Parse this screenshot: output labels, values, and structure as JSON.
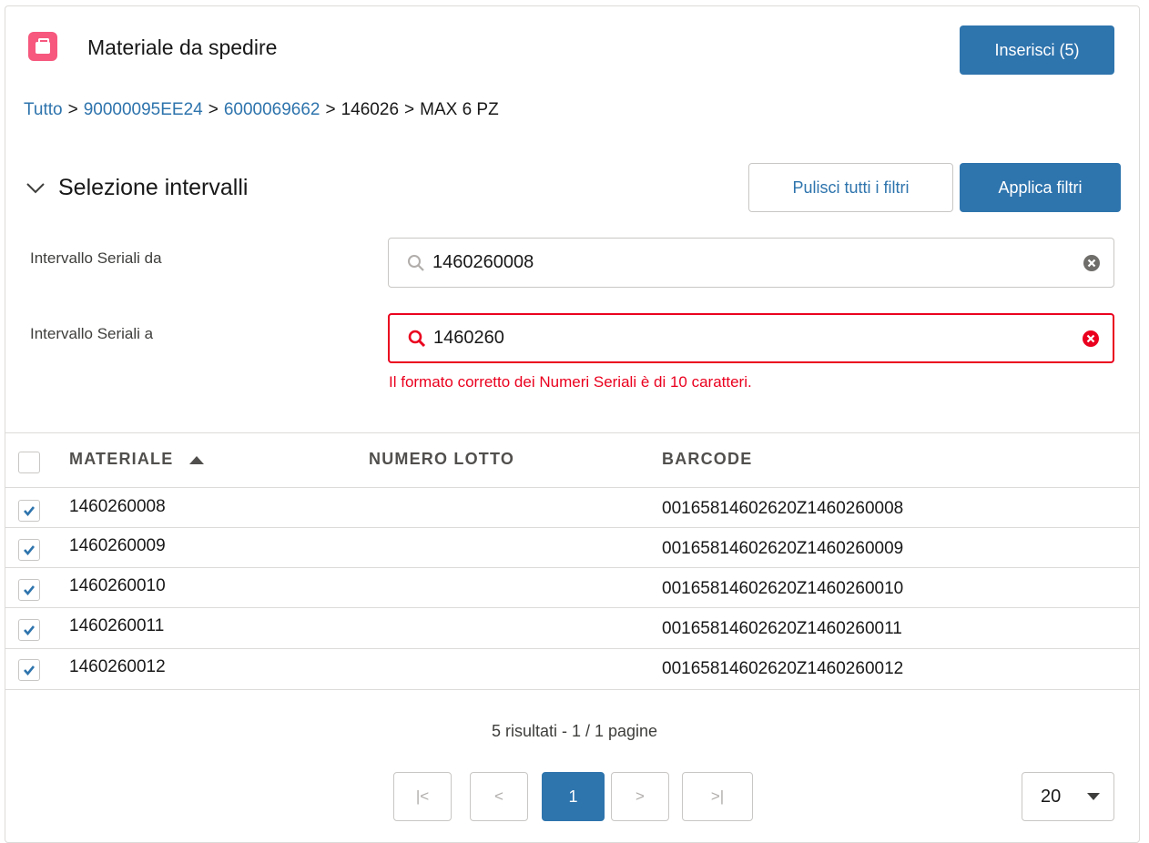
{
  "header": {
    "title": "Materiale da spedire",
    "insert_button": "Inserisci (5)",
    "icon": "briefcase-icon",
    "icon_color": "#f6587e"
  },
  "breadcrumb": {
    "items": [
      "Tutto",
      "90000095EE24",
      "6000069662",
      "146026",
      "MAX 6 PZ"
    ],
    "separator": ">"
  },
  "filters": {
    "section_title": "Selezione intervalli",
    "clear_button": "Pulisci tutti i filtri",
    "apply_button": "Applica filtri",
    "from": {
      "label": "Intervallo Seriali da",
      "value": "1460260008"
    },
    "to": {
      "label": "Intervallo Seriali a",
      "value": "1460260",
      "error": "Il formato corretto dei Numeri Seriali è di 10 caratteri."
    }
  },
  "table": {
    "columns": [
      "MATERIALE",
      "NUMERO LOTTO",
      "BARCODE"
    ],
    "sort_column": "MATERIALE",
    "sort_direction": "ascending",
    "rows": [
      {
        "materiale": "1460260008",
        "lotto": "",
        "barcode": "00165814602620Z1460260008",
        "checked": true
      },
      {
        "materiale": "1460260009",
        "lotto": "",
        "barcode": "00165814602620Z1460260009",
        "checked": true
      },
      {
        "materiale": "1460260010",
        "lotto": "",
        "barcode": "00165814602620Z1460260010",
        "checked": true
      },
      {
        "materiale": "1460260011",
        "lotto": "",
        "barcode": "00165814602620Z1460260011",
        "checked": true
      },
      {
        "materiale": "1460260012",
        "lotto": "",
        "barcode": "00165814602620Z1460260012",
        "checked": true
      }
    ]
  },
  "pagination": {
    "results_text": "5 risultati - 1 / 1 pagine",
    "first": "|<",
    "prev": "<",
    "current": "1",
    "next": ">",
    "last": ">|",
    "page_size": "20"
  },
  "colors": {
    "brand": "#2e74ad",
    "error": "#ea001e",
    "border": "#c9c7c5"
  }
}
